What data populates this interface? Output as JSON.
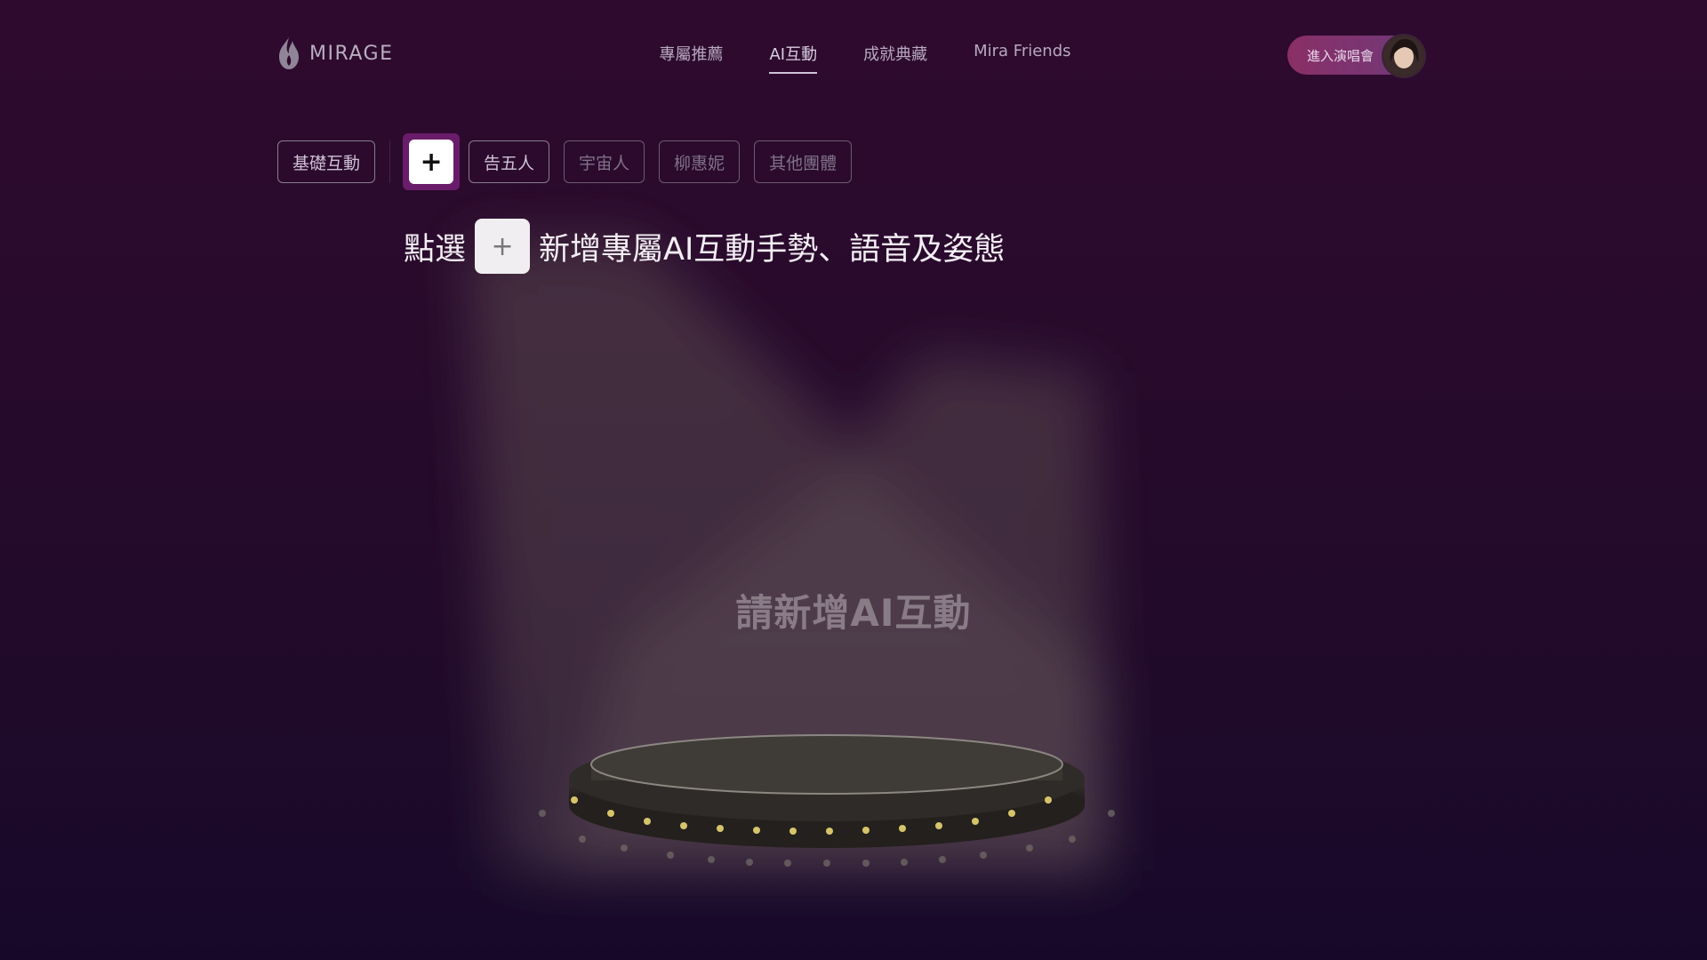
{
  "brand": {
    "name": "MIRAGE"
  },
  "nav": {
    "items": [
      {
        "label": "專屬推薦",
        "active": false
      },
      {
        "label": "AI互動",
        "active": true
      },
      {
        "label": "成就典藏",
        "active": false
      },
      {
        "label": "Mira Friends",
        "active": false
      }
    ]
  },
  "header": {
    "concert_button_label": "進入演唱會"
  },
  "tabs": {
    "first": "基礎互動",
    "add_symbol": "+",
    "items": [
      "告五人",
      "宇宙人",
      "柳惠妮",
      "其他團體"
    ]
  },
  "instruction": {
    "before": "點選",
    "plus": "+",
    "after": "新增專屬AI互動手勢、語音及姿態"
  },
  "placeholder": "請新增AI互動",
  "colors": {
    "accent": "#6a1c6a",
    "background": "#2a0a2c",
    "concert_button": "#8a2f66"
  },
  "icons": {
    "logo": "mirage-flame-logo",
    "add": "plus-icon"
  }
}
